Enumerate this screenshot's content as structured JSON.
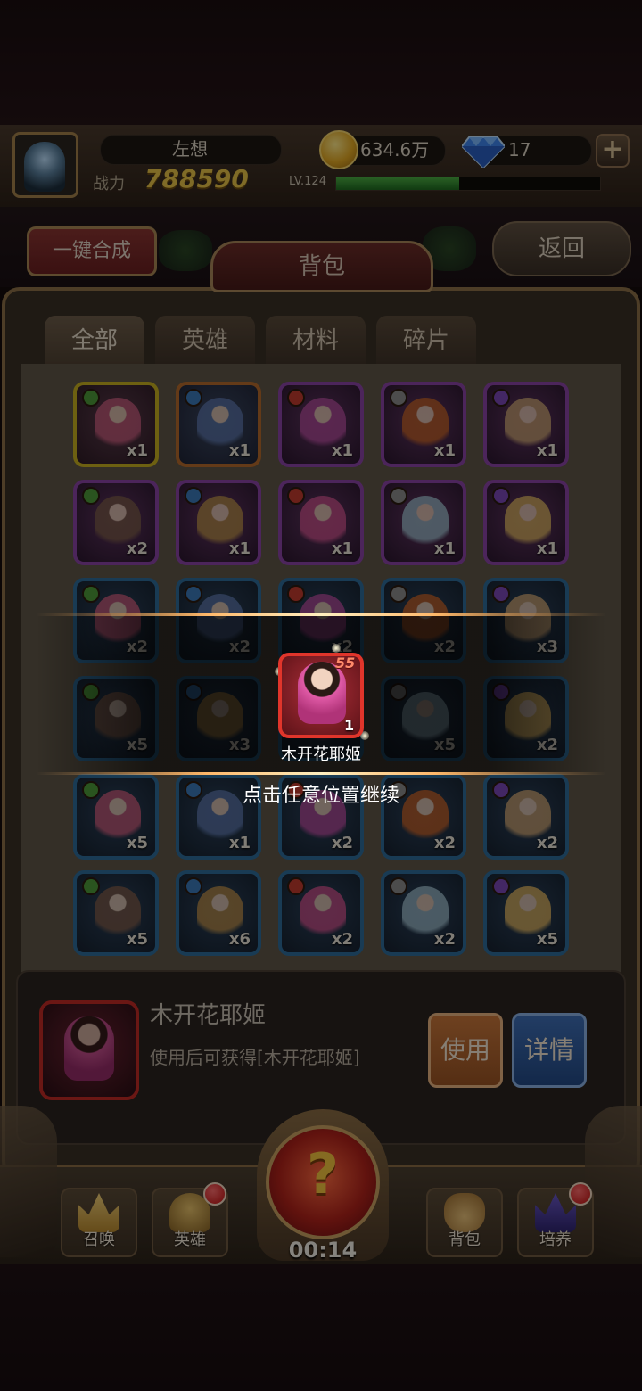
{
  "header": {
    "player_name": "左想",
    "power_label": "战力",
    "power_value": "788590",
    "gold": "634.6万",
    "gems": "17",
    "add_symbol": "+",
    "level_label": "LV.124",
    "exp_fraction": 0.47
  },
  "toolbar": {
    "merge_all_label": "一键合成",
    "back_label": "返回",
    "bag_title": "背包"
  },
  "tabs": [
    {
      "label": "全部",
      "active": true
    },
    {
      "label": "英雄",
      "active": false
    },
    {
      "label": "材料",
      "active": false
    },
    {
      "label": "碎片",
      "active": false
    }
  ],
  "items": [
    {
      "count": "x1",
      "frame": "gold"
    },
    {
      "count": "x1",
      "frame": "orange"
    },
    {
      "count": "x1",
      "frame": "purple"
    },
    {
      "count": "x1",
      "frame": "purple"
    },
    {
      "count": "x1",
      "frame": "purple"
    },
    {
      "count": "x2",
      "frame": "purple"
    },
    {
      "count": "x1",
      "frame": "purple"
    },
    {
      "count": "x1",
      "frame": "purple"
    },
    {
      "count": "x1",
      "frame": "purple"
    },
    {
      "count": "x1",
      "frame": "purple"
    },
    {
      "count": "x2",
      "frame": "blue"
    },
    {
      "count": "x2",
      "frame": "blue"
    },
    {
      "count": "x2",
      "frame": "blue"
    },
    {
      "count": "x2",
      "frame": "blue"
    },
    {
      "count": "x3",
      "frame": "blue"
    },
    {
      "count": "x5",
      "frame": "blue"
    },
    {
      "count": "x3",
      "frame": "blue"
    },
    {
      "count": "",
      "frame": "blue"
    },
    {
      "count": "x5",
      "frame": "blue"
    },
    {
      "count": "x2",
      "frame": "blue"
    },
    {
      "count": "x5",
      "frame": "blue"
    },
    {
      "count": "x1",
      "frame": "blue"
    },
    {
      "count": "x2",
      "frame": "blue"
    },
    {
      "count": "x2",
      "frame": "blue"
    },
    {
      "count": "x2",
      "frame": "blue"
    },
    {
      "count": "x5",
      "frame": "blue"
    },
    {
      "count": "x6",
      "frame": "blue"
    },
    {
      "count": "x2",
      "frame": "blue"
    },
    {
      "count": "x2",
      "frame": "blue"
    },
    {
      "count": "x5",
      "frame": "blue"
    }
  ],
  "reward": {
    "level": "55",
    "count": "1",
    "name": "木开花耶姬",
    "continue_hint": "点击任意位置继续"
  },
  "selected_item": {
    "name": "木开花耶姬",
    "description": "使用后可获得[木开花耶姬]",
    "use_label": "使用",
    "detail_label": "详情"
  },
  "bottom_nav": {
    "summon_label": "召唤",
    "hero_label": "英雄",
    "bag_label": "背包",
    "train_label": "培养",
    "countdown": "00:14",
    "question_symbol": "?"
  }
}
